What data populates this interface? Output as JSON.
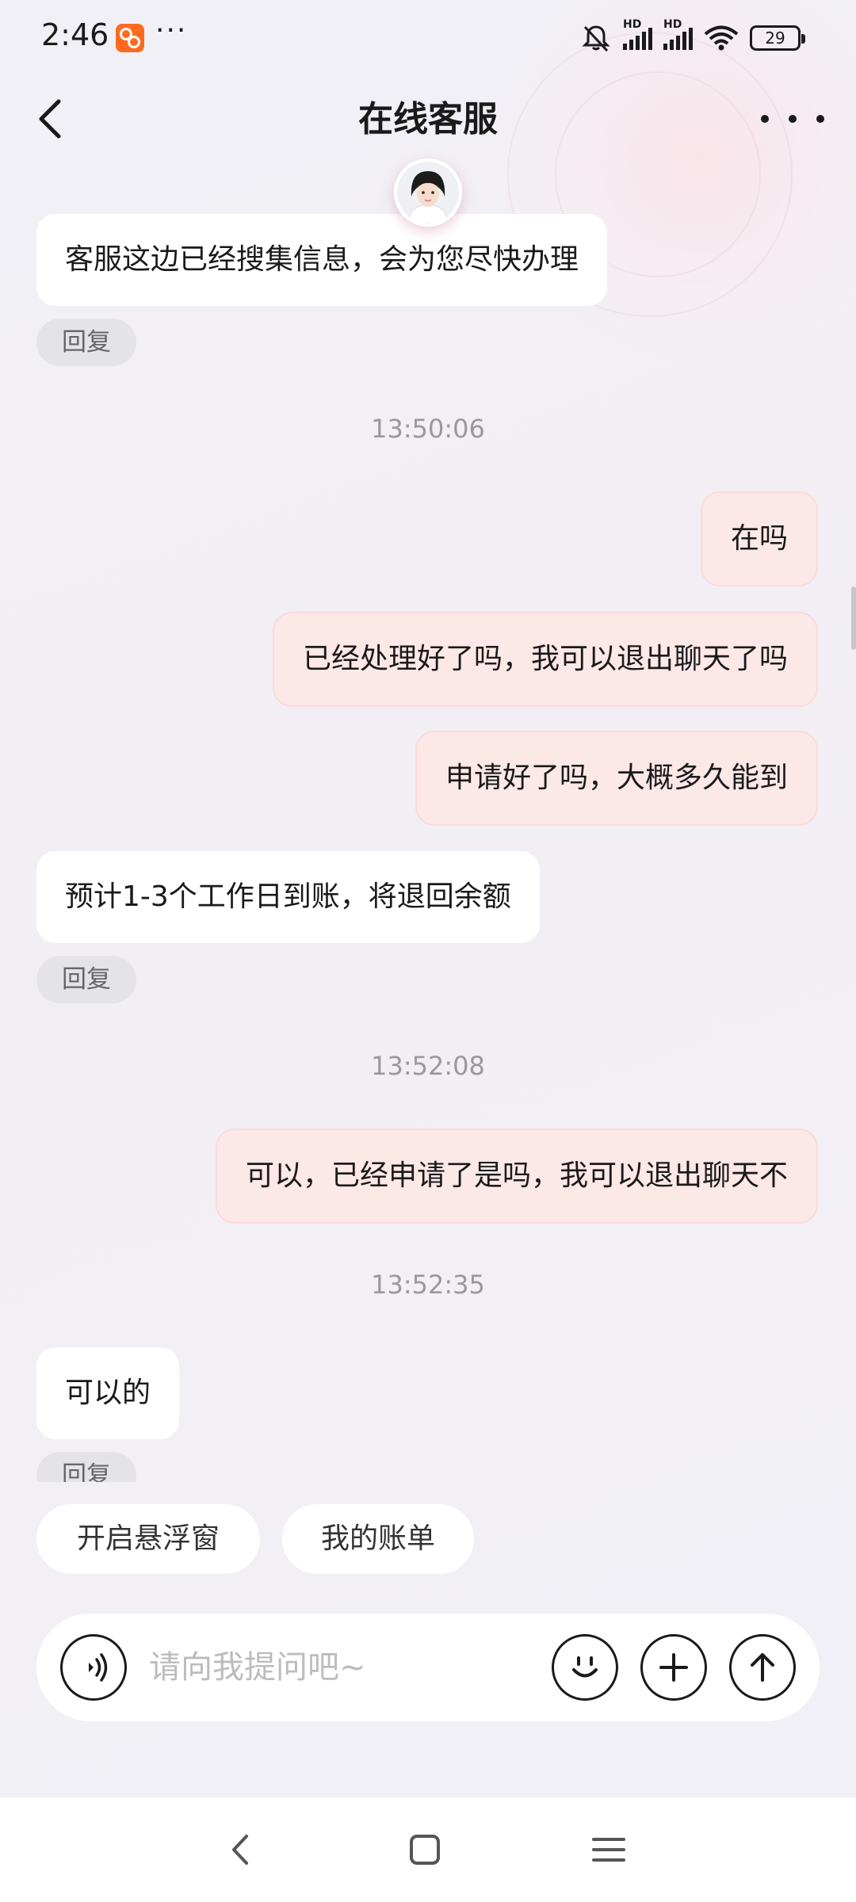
{
  "status": {
    "time": "2:46",
    "more": "···",
    "battery": "29",
    "hd1": "HD",
    "hd2": "HD"
  },
  "header": {
    "title": "在线客服"
  },
  "messages": [
    {
      "side": "left",
      "text": "客服这边已经搜集信息，会为您尽快办理",
      "reply": "回复"
    },
    {
      "timestamp": "13:50:06"
    },
    {
      "side": "right",
      "text": "在吗"
    },
    {
      "side": "right",
      "text": "已经处理好了吗，我可以退出聊天了吗"
    },
    {
      "side": "right",
      "text": "申请好了吗，大概多久能到"
    },
    {
      "side": "left",
      "text": "预计1-3个工作日到账，将退回余额",
      "reply": "回复"
    },
    {
      "timestamp": "13:52:08"
    },
    {
      "side": "right",
      "text": "可以，已经申请了是吗，我可以退出聊天不"
    },
    {
      "timestamp": "13:52:35"
    },
    {
      "side": "left",
      "text": "可以的",
      "reply": "回复"
    }
  ],
  "quick_actions": [
    "开启悬浮窗",
    "我的账单"
  ],
  "input": {
    "placeholder": "请向我提问吧~"
  },
  "icons": {
    "back": "back-arrow-icon",
    "more": "more-dots-icon",
    "voice": "voice-icon",
    "emoji": "emoji-icon",
    "plus": "plus-icon",
    "send": "send-up-arrow-icon"
  }
}
